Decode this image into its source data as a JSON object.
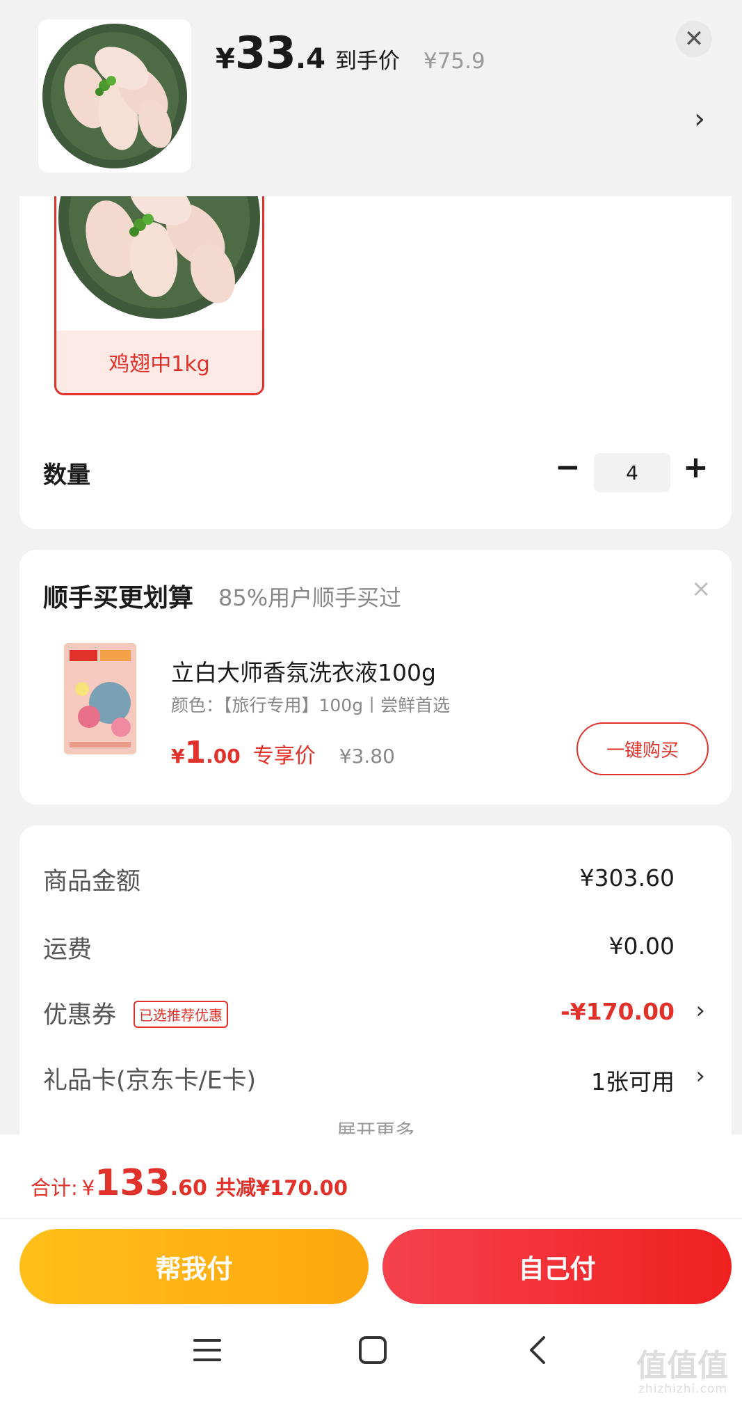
{
  "header": {
    "price_yen": "¥",
    "price_int": "33",
    "price_dec": ".4",
    "price_label": "到手价",
    "original_price": "¥75.9",
    "close_icon": "close-icon",
    "chevron_icon": "chevron-right-icon"
  },
  "variant": {
    "selected_label": "鸡翅中1kg"
  },
  "quantity": {
    "label": "数量",
    "minus": "−",
    "value": "4",
    "plus": "+"
  },
  "upsell": {
    "title": "顺手买更划算",
    "subtitle": "85%用户顺手买过",
    "close": "×",
    "product_name": "立白大师香氛洗衣液100g",
    "spec": "颜色：【旅行专用】100g丨尝鲜首选",
    "price_yen": "¥",
    "price_int": "1",
    "price_dec": ".00",
    "price_tag": "专享价",
    "original_price": "¥3.80",
    "buy_label": "一键购买"
  },
  "summary": {
    "rows": [
      {
        "label": "商品金额",
        "value": "¥303.60"
      },
      {
        "label": "运费",
        "value": "¥0.00"
      },
      {
        "label": "优惠券",
        "badge": "已选推荐优惠",
        "value": "-¥170.00"
      },
      {
        "label": "礼品卡(京东卡/E卡)",
        "value": "1张可用"
      }
    ],
    "more_label": "展开更多"
  },
  "footer": {
    "total_label": "合计:",
    "total_yen": "¥",
    "total_int": "133",
    "total_dec": ".60",
    "total_saved": "共减¥170.00",
    "help_pay_label": "帮我付",
    "self_pay_label": "自己付"
  },
  "system_nav": {
    "menu_icon": "menu-icon",
    "home_icon": "home-icon",
    "back_icon": "back-icon"
  },
  "watermark": {
    "logo": "值值值",
    "site": "zhizhizhi.com"
  },
  "colors": {
    "accent_red": "#e0312a",
    "help_pay_yellow": "#fdb515",
    "self_pay_red": "#f23030",
    "background": "#f2f2f2"
  }
}
